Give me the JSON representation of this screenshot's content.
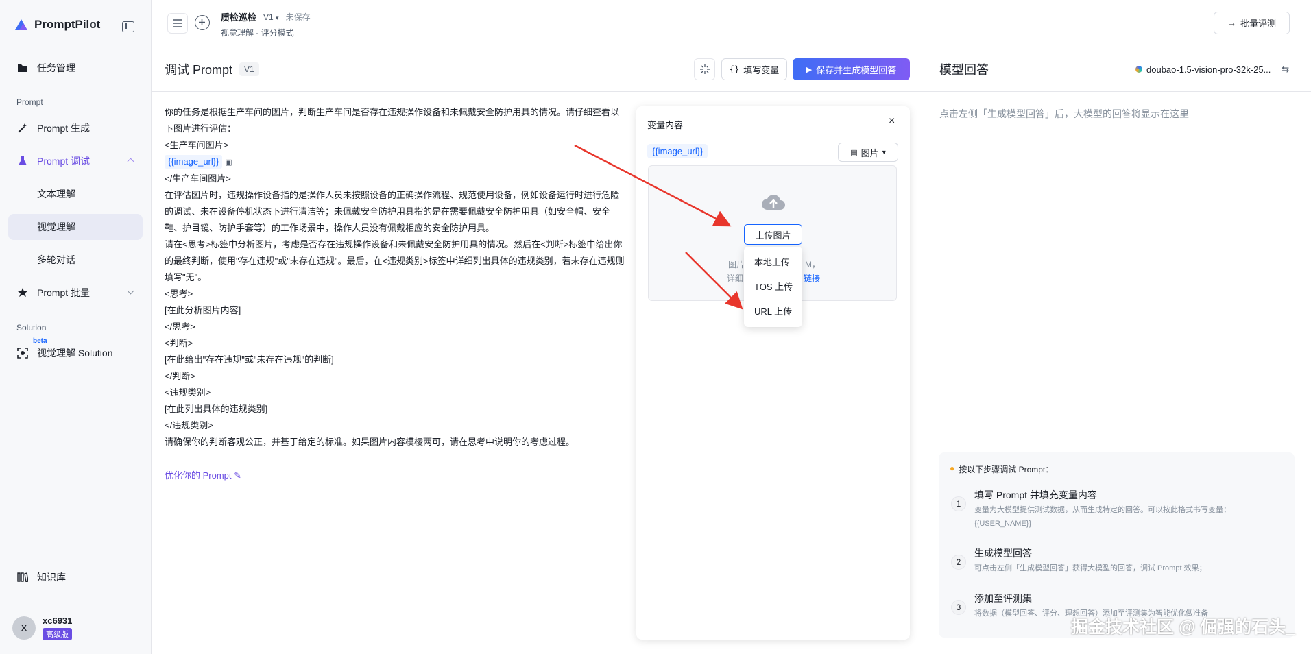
{
  "sidebar": {
    "brand": "PromptPilot",
    "items": [
      {
        "label": "任务管理"
      },
      {
        "label": "Prompt 生成"
      },
      {
        "label": "Prompt 调试"
      },
      {
        "label": "文本理解"
      },
      {
        "label": "视觉理解"
      },
      {
        "label": "多轮对话"
      },
      {
        "label": "Prompt 批量"
      },
      {
        "label": "视觉理解 Solution"
      },
      {
        "label": "知识库"
      }
    ],
    "section_prompt": "Prompt",
    "section_solution": "Solution",
    "beta": "beta",
    "user": {
      "initial": "X",
      "name": "xc6931",
      "plan": "高级版"
    }
  },
  "header": {
    "title": "质检巡检",
    "version": "V1",
    "status": "未保存",
    "subtitle": "视觉理解 - 评分模式",
    "batch_eval": "批量评测"
  },
  "prompt_pane": {
    "title": "调试 Prompt",
    "version": "V1",
    "fill_vars": "填写变量",
    "save_generate": "保存并生成模型回答",
    "optimize": "优化你的 Prompt",
    "lines": {
      "p1": "你的任务是根据生产车间的图片，判断生产车间是否存在违规操作设备和未佩戴安全防护用具的情况。请仔细查看以下图片进行评估：",
      "p2": "<生产车间图片>",
      "var": "{{image_url}}",
      "p3": "</生产车间图片>",
      "p4": "在评估图片时，违规操作设备指的是操作人员未按照设备的正确操作流程、规范使用设备，例如设备运行时进行危险的调试、未在设备停机状态下进行清洁等；未佩戴安全防护用具指的是在需要佩戴安全防护用具（如安全帽、安全鞋、护目镜、防护手套等）的工作场景中，操作人员没有佩戴相应的安全防护用具。",
      "p5": "请在<思考>标签中分析图片，考虑是否存在违规操作设备和未佩戴安全防护用具的情况。然后在<判断>标签中给出你的最终判断，使用\"存在违规\"或\"未存在违规\"。最后，在<违规类别>标签中详细列出具体的违规类别，若未存在违规则填写\"无\"。",
      "p6": "<思考>",
      "p7": "[在此分析图片内容]",
      "p8": "</思考>",
      "p9": "<判断>",
      "p10": "[在此给出\"存在违规\"或\"未存在违规\"的判断]",
      "p11": "</判断>",
      "p12": "<违规类别>",
      "p13": "[在此列出具体的违规类别]",
      "p14": "</违规类别>",
      "p15": "请确保你的判断客观公正，并基于给定的标准。如果图片内容模棱两可，请在思考中说明你的考虑过程。"
    }
  },
  "var_panel": {
    "title": "变量内容",
    "close": "×",
    "var_name": "{{image_url}}",
    "type": "图片",
    "upload": "上传图片",
    "hint1_left": "图片",
    "hint1_right": "M，",
    "hint2_left": "详细",
    "hint2_right": "链接",
    "menu": [
      "本地上传",
      "TOS 上传",
      "URL 上传"
    ]
  },
  "answer_panel": {
    "title": "模型回答",
    "model": "doubao-1.5-vision-pro-32k-25...",
    "placeholder": "点击左侧「生成模型回答」后，大模型的回答将显示在这里",
    "guide_title": "按以下步骤调试 Prompt：",
    "steps": [
      {
        "n": "1",
        "title": "填写 Prompt 并填充变量内容",
        "desc1": "变量为大模型提供测试数据，从而生成特定的回答。可以按此格式书写变量：",
        "desc2": "{{USER_NAME}}"
      },
      {
        "n": "2",
        "title": "生成模型回答",
        "desc1": "可点击左侧「生成模型回答」获得大模型的回答，调试 Prompt 效果；"
      },
      {
        "n": "3",
        "title": "添加至评测集",
        "desc1": "将数据（模型回答、评分、理想回答）添加至评测集为智能优化做准备"
      }
    ]
  },
  "watermark": "掘金技术社区 @ 倔强的石头_",
  "colors": {
    "accent": "#1664ff",
    "purple": "#6a4de3",
    "arrow": "#e8362c"
  }
}
